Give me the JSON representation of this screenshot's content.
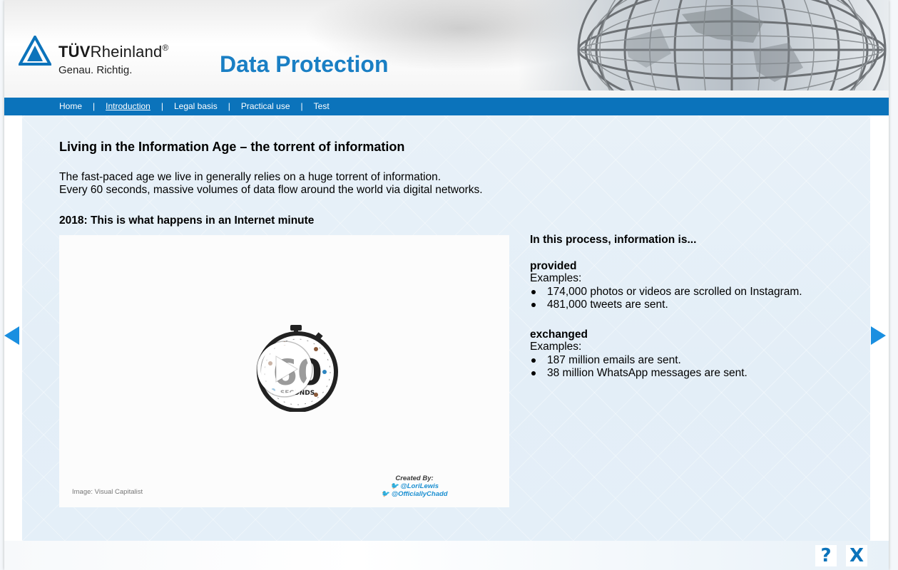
{
  "header": {
    "brand_name_bold": "TÜV",
    "brand_name_rest": "Rheinland",
    "brand_reg": "®",
    "brand_tagline": "Genau. Richtig.",
    "app_title": "Data Protection"
  },
  "nav": {
    "items": [
      {
        "label": "Home",
        "active": false
      },
      {
        "label": "Introduction",
        "active": true
      },
      {
        "label": "Legal basis",
        "active": false
      },
      {
        "label": "Practical use",
        "active": false
      },
      {
        "label": "Test",
        "active": false
      }
    ],
    "separator": "|"
  },
  "main": {
    "heading": "Living in the Information Age – the torrent of information",
    "intro_line1": "The fast-paced age we live in generally relies on a huge torrent of information.",
    "intro_line2": "Every 60 seconds, massive volumes of data flow around the world via digital networks.",
    "subheading": "2018: This is what happens in an Internet minute",
    "video": {
      "stopwatch_number": "60",
      "stopwatch_label": "SECONDS",
      "image_credit": "Image: Visual Capitalist",
      "created_by": "Created By:",
      "handle1": "@LoriLewis",
      "handle2": "@OfficiallyChadd"
    },
    "side": {
      "title": "In this process, information is...",
      "groups": [
        {
          "term": "provided",
          "examples_label": "Examples:",
          "items": [
            "174,000 photos or videos are scrolled on Instagram.",
            "481,000 tweets are sent."
          ]
        },
        {
          "term": "exchanged",
          "examples_label": "Examples:",
          "items": [
            "187 million emails are sent.",
            "38 million WhatsApp messages are sent."
          ]
        }
      ]
    }
  },
  "footer": {
    "help_label": "?",
    "close_label": "X"
  },
  "icons": {
    "prev": "triangle-left-icon",
    "next": "triangle-right-icon",
    "play": "play-icon"
  },
  "colors": {
    "accent": "#0b73bb",
    "title": "#1a7fc4",
    "panel": "#e3eef7"
  }
}
